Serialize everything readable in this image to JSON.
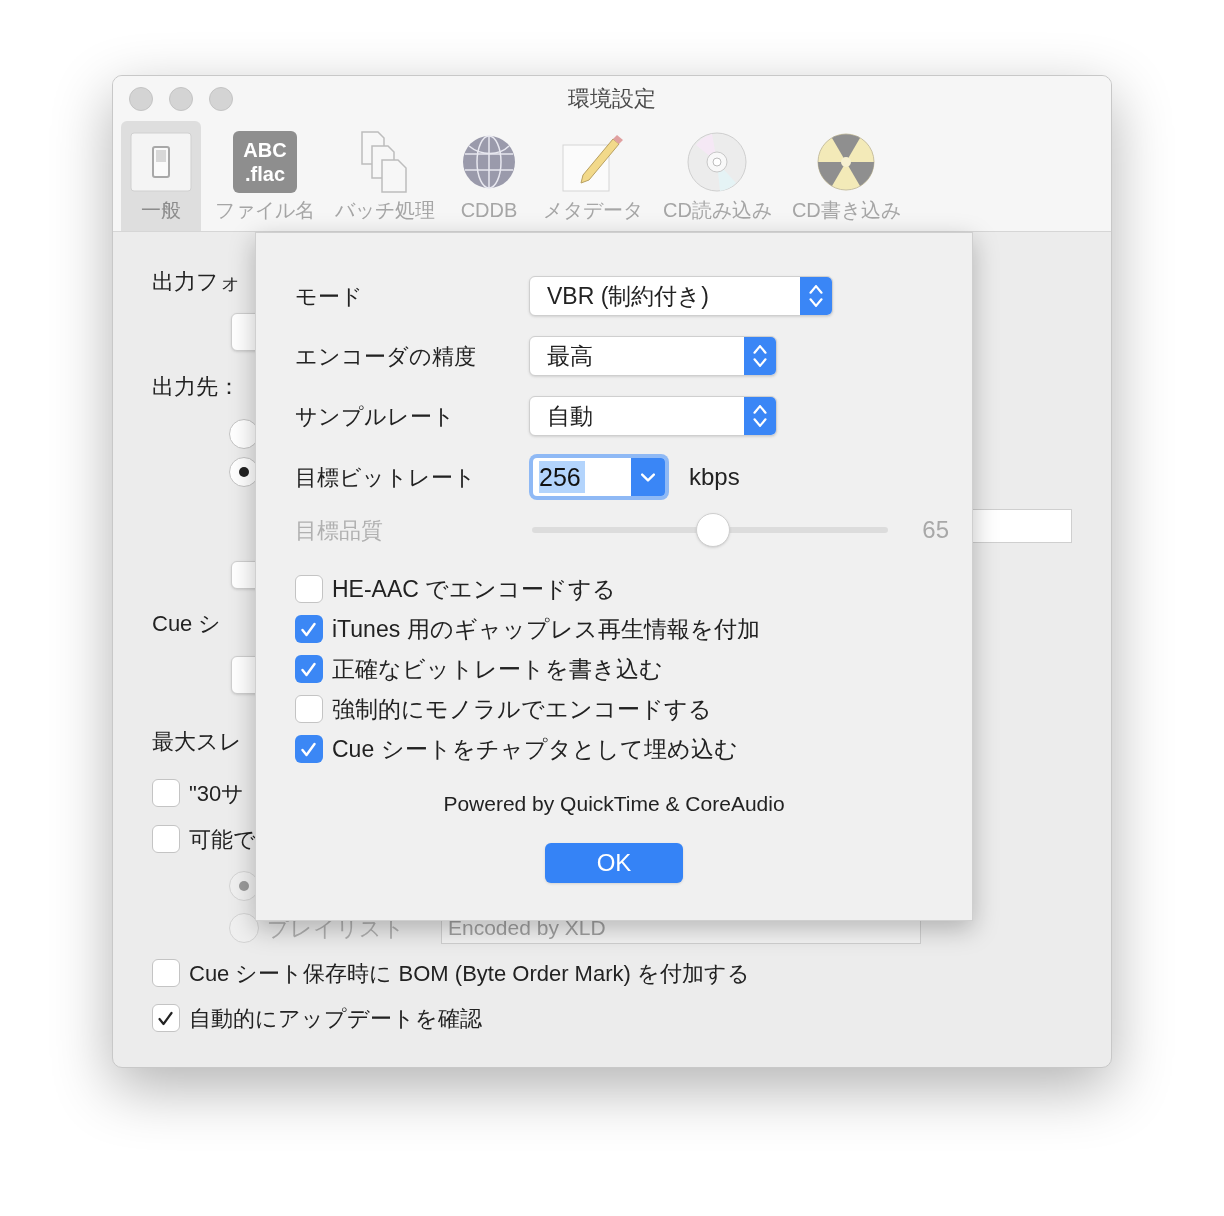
{
  "window": {
    "title": "環境設定"
  },
  "toolbar": [
    {
      "kind": "general",
      "label": "一般",
      "selected": true
    },
    {
      "kind": "filename",
      "label": "ファイル名",
      "icon_text": [
        "ABC",
        ".flac"
      ],
      "selected": false
    },
    {
      "kind": "batch",
      "label": "バッチ処理",
      "selected": false
    },
    {
      "kind": "cddb",
      "label": "CDDB",
      "selected": false
    },
    {
      "kind": "metadata",
      "label": "メタデータ",
      "selected": false
    },
    {
      "kind": "cd-read",
      "label": "CD読み込み",
      "selected": false
    },
    {
      "kind": "cd-write",
      "label": "CD書き込み",
      "selected": false
    }
  ],
  "general_pane": {
    "output_format_label": "出力フォ",
    "output_dest_label": "出力先：",
    "dest_radios": [
      {
        "selected": false
      },
      {
        "selected": true
      }
    ],
    "cue_label": "Cue シ",
    "threads_label": "最大スレ",
    "options": [
      {
        "label": "\"30サ",
        "checked": false
      },
      {
        "label": "可能で",
        "checked": false
      }
    ],
    "sub_radios": [
      {
        "selected": true,
        "disabled": true
      },
      {
        "label": "プレイリスト",
        "selected": false,
        "disabled": true
      }
    ],
    "playlist_field": {
      "value": "Encoded by XLD"
    },
    "bottom_options": [
      {
        "label": "Cue シート保存時に BOM (Byte Order Mark) を付加する",
        "checked": false
      },
      {
        "label": "自動的にアップデートを確認",
        "checked": true
      }
    ]
  },
  "sheet": {
    "rows": [
      {
        "kind": "popup",
        "label": "モード",
        "value": "VBR (制約付き)"
      },
      {
        "kind": "popup",
        "label": "エンコーダの精度",
        "value": "最高"
      },
      {
        "kind": "popup",
        "label": "サンプルレート",
        "value": "自動"
      },
      {
        "kind": "combo",
        "label": "目標ビットレート",
        "value": "256",
        "unit": "kbps"
      },
      {
        "kind": "slider",
        "label": "目標品質",
        "level": 0.51,
        "reading": "65",
        "disabled": true
      }
    ],
    "checkboxes": [
      {
        "label": "HE-AAC でエンコードする",
        "checked": false
      },
      {
        "label": "iTunes 用のギャップレス再生情報を付加",
        "checked": true
      },
      {
        "label": "正確なビットレートを書き込む",
        "checked": true
      },
      {
        "label": "強制的にモノラルでエンコードする",
        "checked": false
      },
      {
        "label": "Cue シートをチャプタとして埋め込む",
        "checked": true
      }
    ],
    "credit": "Powered by QuickTime & CoreAudio",
    "ok_button": "OK"
  }
}
